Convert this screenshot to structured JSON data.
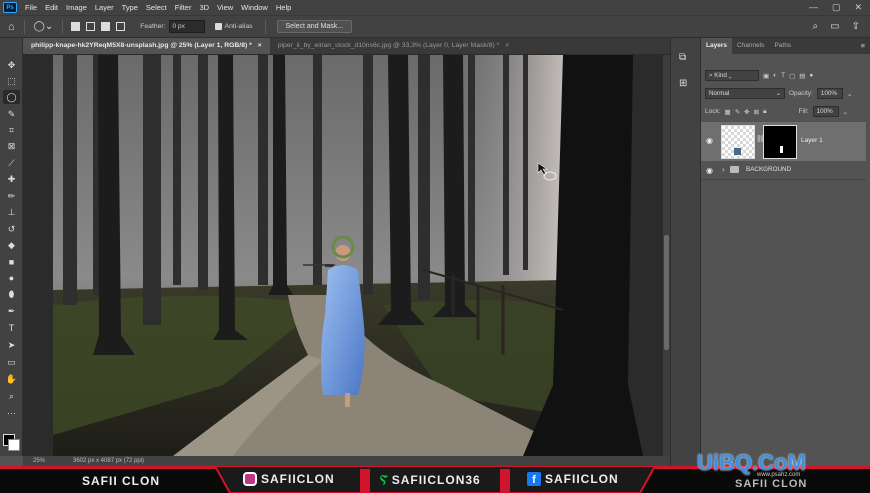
{
  "menu": [
    "File",
    "Edit",
    "Image",
    "Layer",
    "Type",
    "Select",
    "Filter",
    "3D",
    "View",
    "Window",
    "Help"
  ],
  "logo_text": "Ps",
  "options": {
    "feather_label": "Feather:",
    "feather_value": "0 px",
    "antialias_label": "Anti-alias",
    "select_mask_label": "Select and Mask..."
  },
  "tabs": [
    {
      "label": "philipp-knape-hk2YReqM5X8-unsplash.jpg @ 25% (Layer 1, RGB/8) *",
      "close": "×"
    },
    {
      "label": "piper_ii_by_eirian_stock_d10ns6c.jpg @ 33,3% (Layer 0, Layer Mask/8) *",
      "close": "×"
    }
  ],
  "status": {
    "zoom": "25%",
    "size": "3602 px x 4087 px (72 ppi)"
  },
  "panel": {
    "tabs": [
      "Layers",
      "Channels",
      "Paths"
    ],
    "kind": "Kind",
    "blend": "Normal",
    "opacity_label": "Opacity:",
    "opacity_value": "100%",
    "lock_label": "Lock:",
    "fill_label": "Fill:",
    "fill_value": "100%",
    "layers": [
      {
        "name": "Layer 1"
      },
      {
        "name": "BACKGROUND"
      }
    ]
  },
  "banner": {
    "name": "SAFII CLON",
    "socials": [
      {
        "label": "SAFIICLON",
        "icon": "instagram-icon"
      },
      {
        "label": "SAFIICLON36",
        "icon": "deviantart-icon"
      },
      {
        "label": "SAFIICLON",
        "icon": "facebook-icon"
      }
    ],
    "name_right": "SAFII CLON",
    "watermark": "UiBQ.CoM",
    "watermark_sub": "www.psahz.com"
  },
  "colors": {
    "accent_red": "#d0142a",
    "blue_watermark": "#3d8fe0"
  }
}
